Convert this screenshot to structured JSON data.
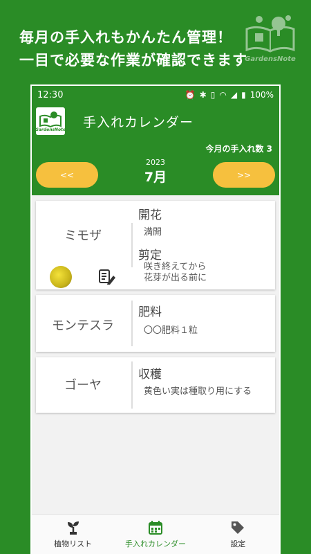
{
  "promo": {
    "line1": "毎月の手入れもかんたん管理！",
    "line2": "一目で必要な作業が確認できます"
  },
  "brand": {
    "name": "GardensNote"
  },
  "status_bar": {
    "time": "12:30",
    "battery": "100%"
  },
  "app_bar": {
    "title": "手入れカレンダー",
    "logo_text": "GardensNote"
  },
  "header": {
    "count_label": "今月の手入れ数 3",
    "year": "2023",
    "month": "7月",
    "prev_label": "<<",
    "next_label": ">>"
  },
  "plants": [
    {
      "name": "ミモザ",
      "tasks": [
        {
          "title": "開花",
          "note": "満開"
        },
        {
          "title": "剪定",
          "note_line1": "咲き終えてから",
          "note_line2": "花芽が出る前に"
        }
      ]
    },
    {
      "name": "モンテスラ",
      "tasks": [
        {
          "title": "肥料",
          "note": "〇〇肥料１粒"
        }
      ]
    },
    {
      "name": "ゴーヤ",
      "tasks": [
        {
          "title": "収穫",
          "note": "黄色い実は種取り用にする"
        }
      ]
    }
  ],
  "bottom_nav": {
    "items": [
      {
        "label": "植物リスト"
      },
      {
        "label": "手入れカレンダー"
      },
      {
        "label": "設定"
      }
    ]
  },
  "colors": {
    "primary": "#2a8c26",
    "accent": "#f6c03e"
  }
}
